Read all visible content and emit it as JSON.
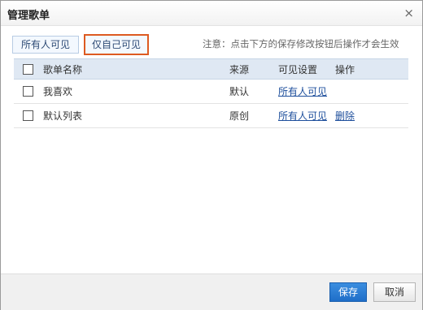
{
  "dialog": {
    "title": "管理歌单",
    "close_icon": "close-icon"
  },
  "toolbar": {
    "all_visible_label": "所有人可见",
    "self_visible_label": "仅自己可见",
    "notice": "注意：点击下方的保存修改按钮后操作才会生效"
  },
  "table": {
    "headers": {
      "name": "歌单名称",
      "source": "来源",
      "visibility": "可见设置",
      "action": "操作"
    },
    "rows": [
      {
        "name": "我喜欢",
        "source": "默认",
        "visibility": "所有人可见",
        "action": ""
      },
      {
        "name": "默认列表",
        "source": "原创",
        "visibility": "所有人可见",
        "action": "删除"
      }
    ]
  },
  "footer": {
    "save_label": "保存",
    "cancel_label": "取消"
  },
  "colors": {
    "accent_border": "#dd5a21",
    "header_bg": "#dfe8f3",
    "link": "#1e4f9c",
    "primary_button": "#1f6ec8"
  }
}
